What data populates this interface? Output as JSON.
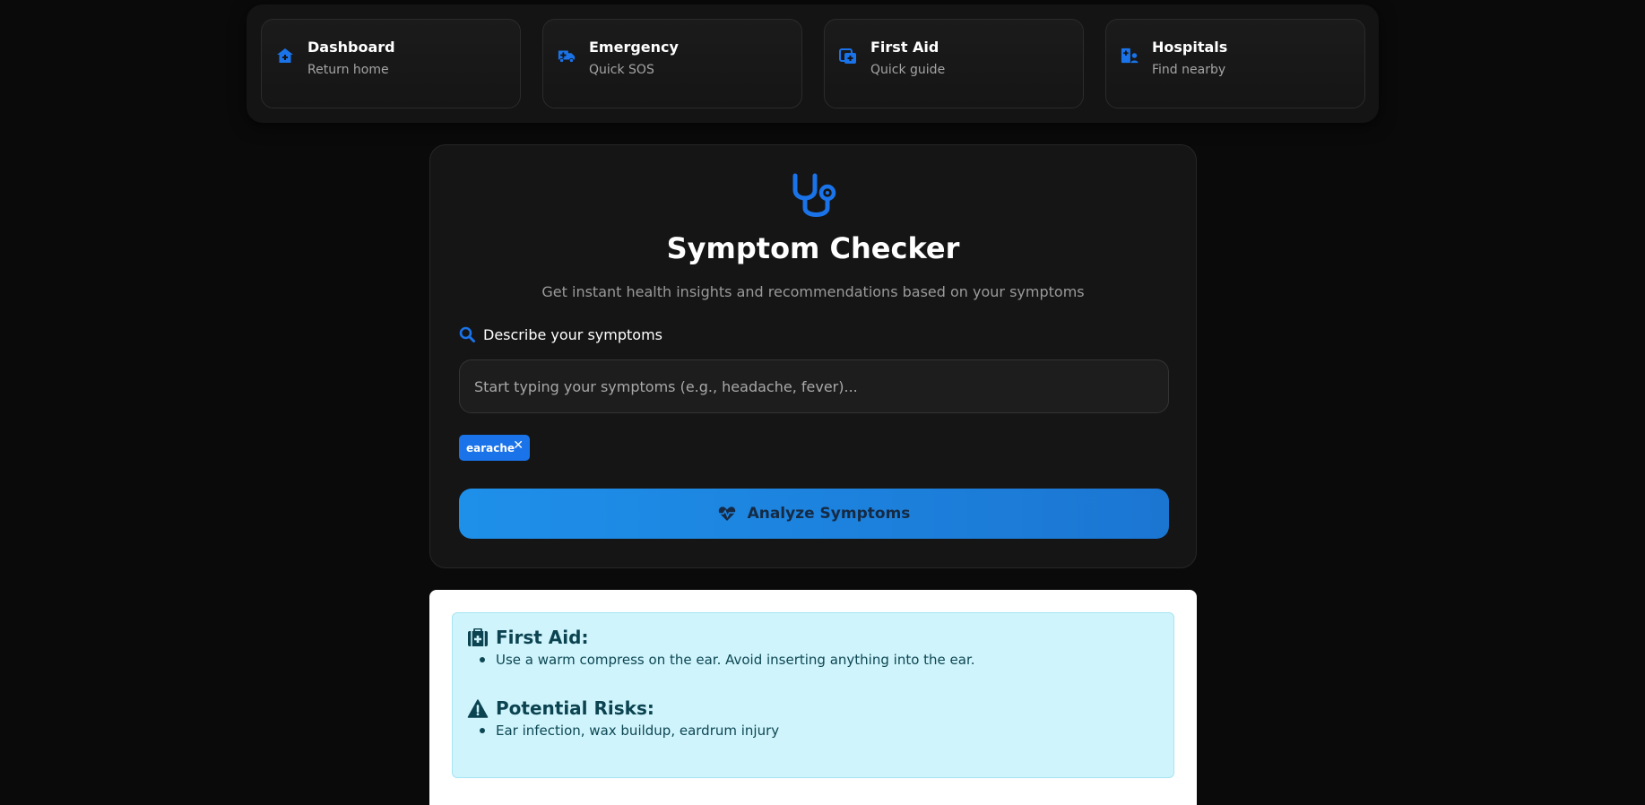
{
  "nav": [
    {
      "title": "Dashboard",
      "subtitle": "Return home",
      "icon": "home-icon"
    },
    {
      "title": "Emergency",
      "subtitle": "Quick SOS",
      "icon": "ambulance-icon"
    },
    {
      "title": "First Aid",
      "subtitle": "Quick guide",
      "icon": "first-aid-icon"
    },
    {
      "title": "Hospitals",
      "subtitle": "Find nearby",
      "icon": "hospital-user-icon"
    }
  ],
  "checker": {
    "icon": "stethoscope-icon",
    "title": "Symptom Checker",
    "subtitle": "Get instant health insights and recommendations based on your symptoms",
    "label": "Describe your symptoms",
    "label_icon": "search-icon",
    "input_placeholder": "Start typing your symptoms (e.g., headache, fever)...",
    "input_value": "",
    "tags": [
      {
        "label": "earache",
        "remove": "✕"
      }
    ],
    "analyze_label": "Analyze Symptoms",
    "analyze_icon": "heart-pulse-icon"
  },
  "results": {
    "first_aid": {
      "heading": "First Aid:",
      "icon": "medkit-icon",
      "items": [
        "Use a warm compress on the ear. Avoid inserting anything into the ear."
      ]
    },
    "risks": {
      "heading": "Potential Risks:",
      "icon": "warning-icon",
      "items": [
        "Ear infection, wax buildup, eardrum injury"
      ]
    }
  },
  "colors": {
    "accent": "#1a73e8",
    "background": "#0a0a0a",
    "card": "#151515",
    "alert_bg": "#cff4fc",
    "alert_text": "#0d4753"
  }
}
